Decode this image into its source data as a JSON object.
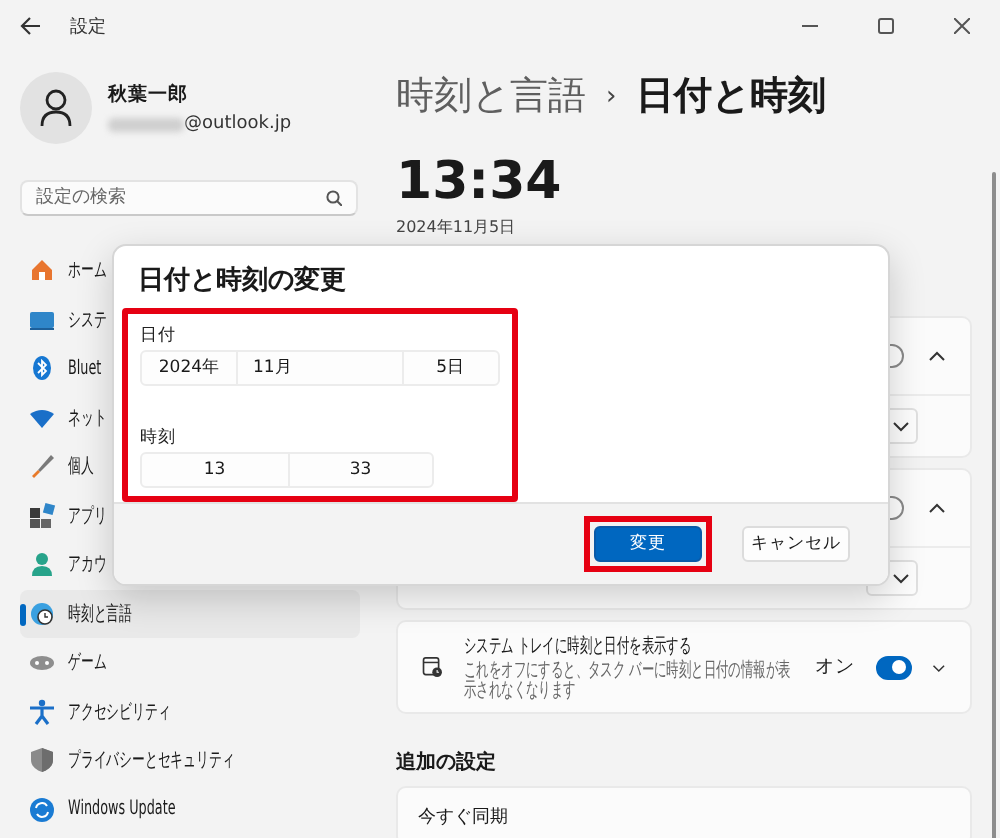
{
  "window": {
    "title": "設定"
  },
  "account": {
    "name": "秋葉一郎",
    "email": "@outlook.jp"
  },
  "search": {
    "placeholder": "設定の検索"
  },
  "sidebar": {
    "items": [
      {
        "label": "ホーム",
        "selected": false
      },
      {
        "label": "システ",
        "selected": false
      },
      {
        "label": "Bluet",
        "selected": false
      },
      {
        "label": "ネット",
        "selected": false
      },
      {
        "label": "個人",
        "selected": false
      },
      {
        "label": "アプリ",
        "selected": false
      },
      {
        "label": "アカウ",
        "selected": false
      },
      {
        "label": "時刻と言語",
        "selected": true
      },
      {
        "label": "ゲーム",
        "selected": false
      },
      {
        "label": "アクセシビリティ",
        "selected": false
      },
      {
        "label": "プライバシーとセキュリティ",
        "selected": false
      },
      {
        "label": "Windows Update",
        "selected": false
      }
    ]
  },
  "breadcrumb": {
    "parent": "時刻と言語",
    "separator": "›",
    "current": "日付と時刻"
  },
  "clock": {
    "time": "13:34",
    "date": "2024年11月5日"
  },
  "cards": [
    {
      "kind": "covered",
      "on": false
    },
    {
      "kind": "covered",
      "on": false
    },
    {
      "kind": "toggle",
      "title": "システム トレイに時刻と日付を表示する",
      "description": "これをオフにすると、タスク バーに時刻と日付の情報が表示されなくなります",
      "state_label": "オン",
      "on": true
    }
  ],
  "additional": {
    "heading": "追加の設定",
    "items": [
      "今すぐ同期"
    ]
  },
  "dialog": {
    "title": "日付と時刻の変更",
    "fields_highlighted": true,
    "date_label": "日付",
    "date": [
      "2024年",
      "11月",
      "5日"
    ],
    "time_label": "時刻",
    "time": [
      "13",
      "33"
    ],
    "buttons": [
      {
        "label": "変更",
        "kind": "primary",
        "highlighted": true
      },
      {
        "label": "キャンセル",
        "kind": "secondary",
        "highlighted": false
      }
    ]
  }
}
